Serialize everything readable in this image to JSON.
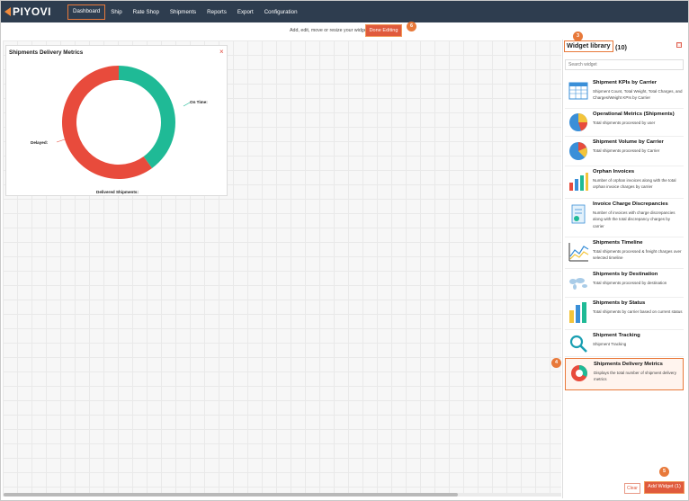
{
  "app": {
    "logo_text": "PIYOVI"
  },
  "nav": {
    "items": [
      "Dashboard",
      "Ship",
      "Rate Shop",
      "Shipments",
      "Reports",
      "Export",
      "Configuration"
    ],
    "active": "Dashboard"
  },
  "toolbar": {
    "message": "Add, edit, move or resize your widgets",
    "done_label": "Done Editing"
  },
  "steps": {
    "done": "6",
    "library": "3",
    "selected": "4",
    "add": "5"
  },
  "widget": {
    "title": "Shipments Delivery Metrics",
    "close_glyph": "×",
    "label_on_time": "On Time:",
    "label_delayed": "Delayed:",
    "label_center": "Delivered Shipments:",
    "colors": {
      "on_time": "#1fba96",
      "delayed": "#e84b3c"
    }
  },
  "chart_data": {
    "type": "pie",
    "categories": [
      "On Time",
      "Delayed"
    ],
    "values": [
      40,
      60
    ],
    "title": "",
    "colors": [
      "#1fba96",
      "#e84b3c"
    ]
  },
  "library": {
    "title": "Widget library",
    "count": "(10)",
    "close_glyph": "□",
    "search_placeholder": "Search widget",
    "items": [
      {
        "title": "Shipment KPIs by Carrier",
        "desc": "Shipment Count, Total Weight, Total Charges, and Charges/Weight KPIs by Carrier",
        "icon": "kpi-table-icon"
      },
      {
        "title": "Operational Metrics (Shipments)",
        "desc": "Total shipments processed by user",
        "icon": "pie-chart-icon"
      },
      {
        "title": "Shipment Volume by Carrier",
        "desc": "Total shipments processed by Carrier",
        "icon": "pie-chart-icon"
      },
      {
        "title": "Orphan Invoices",
        "desc": "Number of orphan invoices along with the total orphan invoice charges by carrier",
        "icon": "bar-chart-icon"
      },
      {
        "title": "Invoice Charge Discrepancies",
        "desc": "Number of invoices with charge discrepancies along with the total discrepancy charges by carrier",
        "icon": "document-icon"
      },
      {
        "title": "Shipments Timeline",
        "desc": "Total shipments processed & freight charges over selected timeline",
        "icon": "line-chart-icon"
      },
      {
        "title": "Shipments by Destination",
        "desc": "Total shipments processed by destination",
        "icon": "world-map-icon"
      },
      {
        "title": "Shipments by Status",
        "desc": "Total shipments by carrier based on current status",
        "icon": "bar-chart-icon"
      },
      {
        "title": "Shipment Tracking",
        "desc": "Shipment Tracking",
        "icon": "magnifier-icon"
      },
      {
        "title": "Shipments Delivery Metrics",
        "desc": "Displays the total number of shipment delivery metrics",
        "icon": "donut-chart-icon"
      }
    ],
    "clear_label": "Clear",
    "add_label": "Add Widget (1)"
  }
}
